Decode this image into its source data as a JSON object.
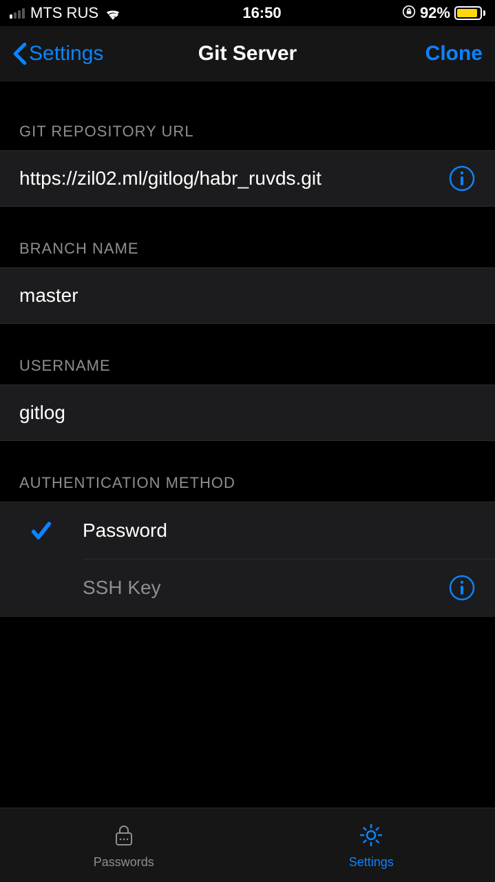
{
  "status": {
    "carrier": "MTS RUS",
    "time": "16:50",
    "battery_pct": "92%",
    "battery_fill": 92
  },
  "nav": {
    "back_label": "Settings",
    "title": "Git Server",
    "action": "Clone"
  },
  "sections": {
    "repo_header": "GIT REPOSITORY URL",
    "repo_value": "https://zil02.ml/gitlog/habr_ruvds.git",
    "branch_header": "BRANCH NAME",
    "branch_value": "master",
    "username_header": "USERNAME",
    "username_value": "gitlog",
    "auth_header": "AUTHENTICATION METHOD",
    "auth_options": {
      "password": "Password",
      "ssh": "SSH Key"
    }
  },
  "tabs": {
    "passwords": "Passwords",
    "settings": "Settings"
  },
  "colors": {
    "accent": "#0a84ff",
    "battery": "#ffd60a"
  }
}
